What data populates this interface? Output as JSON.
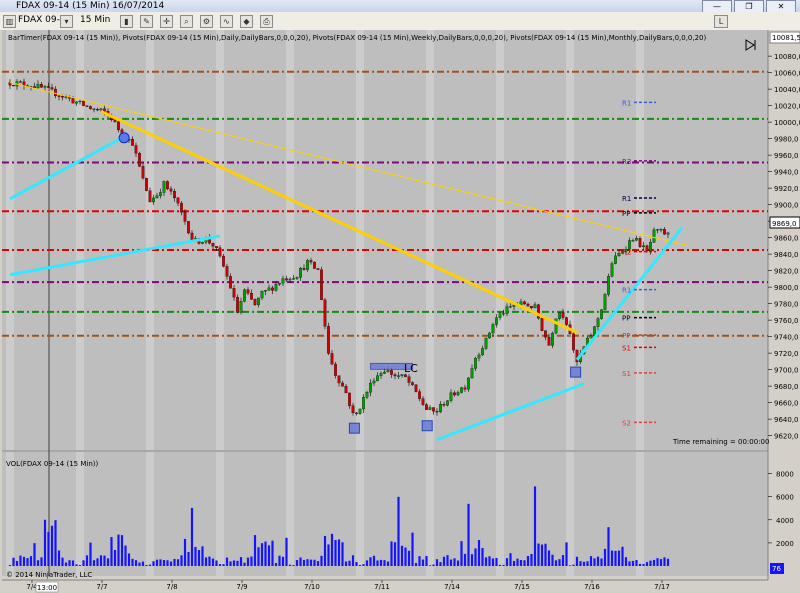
{
  "window": {
    "title": "FDAX 09-14 (15 Min)  16/07/2014",
    "buttons": {
      "minimize": "—",
      "restore": "❐",
      "close": "✕"
    }
  },
  "toolbar": {
    "instrument": "FDAX 09-14",
    "interval": "15 Min",
    "mode_button": "L"
  },
  "icons": [
    "chart-icon",
    "dropdown-icon",
    "bar-type-icon",
    "pencil-icon",
    "crosshair-icon",
    "zoom-icon",
    "properties-icon",
    "indicators-icon",
    "strategy-icon",
    "print-icon"
  ],
  "indicators_label": "BarTimer(FDAX 09-14 (15 Min)), Pivots(FDAX 09-14 (15 Min),Daily,DailyBars,0,0,0,20), Pivots(FDAX 09-14 (15 Min),Weekly,DailyBars,0,0,0,20), Pivots(FDAX 09-14 (15 Min),Monthly,DailyBars,0,0,0,20)",
  "vol_label": "VOL(FDAX 09-14 (15 Min))",
  "copyright": "© 2014 NinjaTrader, LLC",
  "time_remaining": "Time remaining = 00:00:00",
  "annotation_lc": "LC",
  "top_price_label": "10081,5",
  "current_price_label": "9869,0",
  "vol_last_label": "76",
  "colors": {
    "chart_bg": "#bebebe",
    "candle_up": "#00a000",
    "candle_down": "#d00000",
    "volume": "#1414ff",
    "trend_gold": "#ffd000",
    "trend_cyan": "#33e8ff"
  },
  "chart_data": [
    {
      "type": "candlestick",
      "panel": "price",
      "x": [
        "7/4",
        "7/7",
        "7/8",
        "7/9",
        "7/10",
        "7/11",
        "7/14",
        "7/15",
        "7/16",
        "7/17"
      ],
      "x_extra_label": "13:00",
      "ylim": [
        9605,
        10085
      ],
      "y_ticks": [
        9620,
        9640,
        9660,
        9680,
        9700,
        9720,
        9740,
        9760,
        9780,
        9800,
        9820,
        9840,
        9860,
        9880,
        9900,
        9920,
        9940,
        9960,
        9980,
        10000,
        10020,
        10040,
        10060,
        10080
      ],
      "y_tick_labels": [
        "9620,0",
        "9640,0",
        "9660,0",
        "9680,0",
        "9700,0",
        "9720,0",
        "9740,0",
        "9760,0",
        "9780,0",
        "9800,0",
        "9820,0",
        "9840,0",
        "9860,0",
        "9880,0",
        "9900,0",
        "9920,0",
        "9940,0",
        "9960,0",
        "9980,0",
        "10000,0",
        "10020,0",
        "10040,0",
        "10060,0",
        "10080,0"
      ],
      "price_path": [
        [
          0,
          10048
        ],
        [
          0.3,
          10045
        ],
        [
          0.5,
          10040
        ],
        [
          0.8,
          10030
        ],
        [
          1.0,
          10022
        ],
        [
          1.2,
          10015
        ],
        [
          1.35,
          10012
        ],
        [
          1.45,
          10005
        ],
        [
          1.6,
          9985
        ],
        [
          1.75,
          9975
        ],
        [
          1.9,
          9930
        ],
        [
          2.0,
          9905
        ],
        [
          2.1,
          9912
        ],
        [
          2.2,
          9925
        ],
        [
          2.35,
          9908
        ],
        [
          2.5,
          9880
        ],
        [
          2.62,
          9855
        ],
        [
          2.8,
          9858
        ],
        [
          2.92,
          9850
        ],
        [
          3.05,
          9825
        ],
        [
          3.15,
          9800
        ],
        [
          3.25,
          9770
        ],
        [
          3.35,
          9795
        ],
        [
          3.5,
          9778
        ],
        [
          3.6,
          9792
        ],
        [
          3.75,
          9800
        ],
        [
          3.9,
          9810
        ],
        [
          4.1,
          9815
        ],
        [
          4.25,
          9830
        ],
        [
          4.4,
          9820
        ],
        [
          4.55,
          9720
        ],
        [
          4.65,
          9695
        ],
        [
          4.8,
          9672
        ],
        [
          4.92,
          9640
        ],
        [
          5.05,
          9665
        ],
        [
          5.2,
          9690
        ],
        [
          5.35,
          9700
        ],
        [
          5.5,
          9693
        ],
        [
          5.65,
          9690
        ],
        [
          5.8,
          9672
        ],
        [
          5.95,
          9652
        ],
        [
          6.08,
          9648
        ],
        [
          6.2,
          9660
        ],
        [
          6.35,
          9672
        ],
        [
          6.5,
          9680
        ],
        [
          6.65,
          9715
        ],
        [
          6.8,
          9735
        ],
        [
          6.92,
          9760
        ],
        [
          7.05,
          9770
        ],
        [
          7.2,
          9778
        ],
        [
          7.35,
          9780
        ],
        [
          7.5,
          9775
        ],
        [
          7.6,
          9750
        ],
        [
          7.7,
          9730
        ],
        [
          7.82,
          9772
        ],
        [
          7.92,
          9765
        ],
        [
          8.0,
          9745
        ],
        [
          8.08,
          9705
        ],
        [
          8.22,
          9730
        ],
        [
          8.35,
          9750
        ],
        [
          8.47,
          9780
        ],
        [
          8.6,
          9830
        ],
        [
          8.75,
          9845
        ],
        [
          8.9,
          9860
        ],
        [
          9.0,
          9852
        ],
        [
          9.1,
          9842
        ],
        [
          9.2,
          9866
        ],
        [
          9.3,
          9867
        ],
        [
          9.4,
          9863
        ]
      ],
      "pivot_lines": [
        {
          "name": "monthly",
          "price": 10061,
          "color": "#a0521e",
          "label": ""
        },
        {
          "name": "weekly",
          "price": 10004,
          "color": "#148a14",
          "label": ""
        },
        {
          "name": "weekly",
          "price": 9951,
          "color": "#7a0a7a",
          "label": ""
        },
        {
          "name": "daily",
          "price": 9892,
          "color": "#e00000",
          "label": ""
        },
        {
          "name": "daily",
          "price": 9845,
          "color": "#e00000",
          "label": ""
        },
        {
          "name": "weekly",
          "price": 9806,
          "color": "#7a0a7a",
          "label": ""
        },
        {
          "name": "weekly",
          "price": 9770,
          "color": "#148a14",
          "label": ""
        },
        {
          "name": "monthly",
          "price": 9741,
          "color": "#a0521e",
          "label": ""
        }
      ],
      "pivot_labels": [
        {
          "text": "R1",
          "price": 10024,
          "color": "#3b5be0",
          "x": 8.75
        },
        {
          "text": "R3",
          "price": 9953,
          "color": "#7a0a7a",
          "x": 8.75
        },
        {
          "text": "R1",
          "price": 9908,
          "color": "#00004a",
          "x": 8.75
        },
        {
          "text": "PP",
          "price": 9890,
          "color": "#000000",
          "x": 8.75
        },
        {
          "text": "R2",
          "price": 9843,
          "color": "#e00000",
          "x": 8.75
        },
        {
          "text": "R1",
          "price": 9797,
          "color": "#3b5be0",
          "x": 8.75
        },
        {
          "text": "PP",
          "price": 9763,
          "color": "#000000",
          "x": 8.75
        },
        {
          "text": "PP",
          "price": 9742,
          "color": "#a0521e",
          "x": 8.75
        },
        {
          "text": "S1",
          "price": 9727,
          "color": "#e00000",
          "x": 8.75
        },
        {
          "text": "S1",
          "price": 9696,
          "color": "#e04040",
          "x": 8.75
        },
        {
          "text": "S2",
          "price": 9636,
          "color": "#e04040",
          "x": 8.75
        }
      ],
      "trendlines": [
        {
          "color": "gold",
          "width": 2,
          "from": [
            1.3,
            10013
          ],
          "to": [
            8.1,
            9745
          ]
        },
        {
          "color": "gold",
          "width": 1,
          "from": [
            0,
            10048
          ],
          "to": [
            9.7,
            9850
          ]
        },
        {
          "color": "cyan",
          "width": 2,
          "from": [
            0,
            9907
          ],
          "to": [
            1.6,
            9981
          ]
        },
        {
          "color": "cyan",
          "width": 2,
          "from": [
            0,
            9815
          ],
          "to": [
            3.0,
            9862
          ]
        },
        {
          "color": "cyan",
          "width": 2,
          "from": [
            6.1,
            9615
          ],
          "to": [
            8.2,
            9683
          ]
        },
        {
          "color": "cyan",
          "width": 2,
          "from": [
            8.1,
            9712
          ],
          "to": [
            9.6,
            9872
          ]
        }
      ],
      "markers": [
        {
          "shape": "circle",
          "x": 1.63,
          "price": 9981
        },
        {
          "shape": "square",
          "x": 4.92,
          "price": 9629
        },
        {
          "shape": "square",
          "x": 5.96,
          "price": 9632
        },
        {
          "shape": "square",
          "x": 8.08,
          "price": 9697
        }
      ],
      "lc_box": {
        "x1": 5.15,
        "x2": 5.75,
        "price": 9704
      }
    },
    {
      "type": "bar",
      "panel": "volume",
      "title": "VOL(FDAX 09-14 (15 Min))",
      "ylim": [
        0,
        9000
      ],
      "y_ticks": [
        2000,
        4000,
        6000,
        8000
      ],
      "y_tick_labels": [
        "2000",
        "4000",
        "6000",
        "8000"
      ],
      "last_value": 76
    }
  ]
}
